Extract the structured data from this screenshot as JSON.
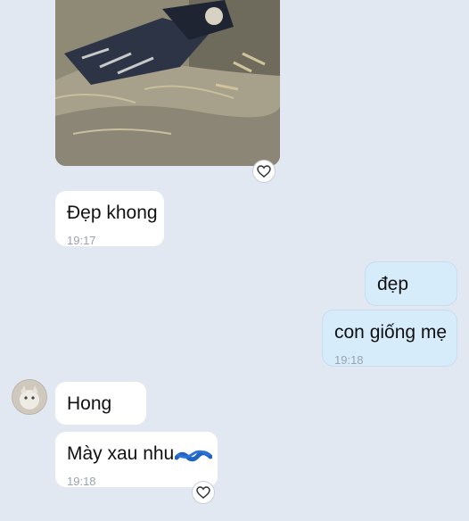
{
  "messages": {
    "m1": {
      "text": "Đẹp khong",
      "time": "19:17"
    },
    "m2": {
      "text": "đẹp"
    },
    "m3": {
      "text": "con giống mẹ",
      "time": "19:18"
    },
    "m4": {
      "text": "Hong"
    },
    "m5": {
      "text": "Mày  xau nhu",
      "time": "19:18"
    }
  },
  "colors": {
    "background": "#e2e8f1",
    "incoming_bubble": "#ffffff",
    "outgoing_bubble": "#d6ecfb",
    "timestamp": "#9aa3ad"
  },
  "icons": {
    "reaction": "heart-outline-icon",
    "avatar": "contact-avatar"
  }
}
